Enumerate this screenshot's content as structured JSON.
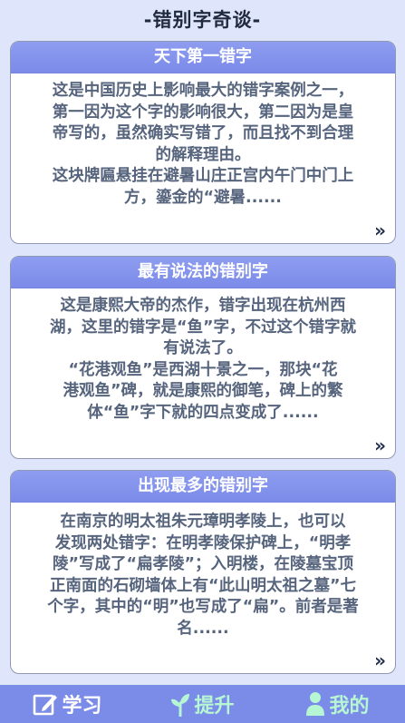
{
  "page": {
    "title": "-错别字奇谈-"
  },
  "cards": [
    {
      "title": "天下第一错字",
      "lines": [
        "这是中国历史上影响最大的错字案例之一，",
        "第一因为这个字的影响很大，第二因为是皇",
        "帝写的，虽然确实写错了，而且找不到合理",
        "的解释理由。",
        "这块牌匾悬挂在避暑山庄正宫内午门中门上",
        "方，鎏金的“避暑......"
      ],
      "more_icon": "»"
    },
    {
      "title": "最有说法的错别字",
      "lines": [
        "这是康熙大帝的杰作，错字出现在杭州西",
        "湖，这里的错字是“鱼”字，不过这个错字就",
        "有说法了。",
        "“花港观鱼”是西湖十景之一，那块“花",
        "港观鱼”碑，就是康熙的御笔，碑上的繁",
        "体“鱼”字下就的四点变成了......"
      ],
      "more_icon": "»"
    },
    {
      "title": "出现最多的错别字",
      "lines": [
        "在南京的明太祖朱元璋明孝陵上，也可以",
        "发现两处错字：在明孝陵保护碑上，“明孝",
        "陵”写成了“扁孝陵”；入明楼，在陵墓宝顶",
        "正南面的石砌墙体上有“此山明太祖之墓”七",
        "个字，其中的“明”也写成了“扁”。前者是著",
        "名......"
      ],
      "more_icon": "»"
    }
  ],
  "nav": {
    "learn": "学习",
    "improve": "提升",
    "mine": "我的"
  },
  "colors": {
    "accent": "#7b8be8",
    "background": "#dfe6fb",
    "active_nav": "#b7f6d3"
  }
}
